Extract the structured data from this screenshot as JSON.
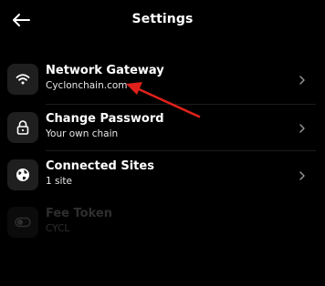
{
  "header": {
    "title": "Settings",
    "back_icon": "arrow-left-icon"
  },
  "settings": [
    {
      "label": "Network Gateway",
      "sub": "Cyclonchain.com",
      "icon": "wifi-icon",
      "enabled": true
    },
    {
      "label": "Change Password",
      "sub": "Your own chain",
      "icon": "lock-icon",
      "enabled": true
    },
    {
      "label": "Connected Sites",
      "sub": "1 site",
      "icon": "globe-icon",
      "enabled": true
    },
    {
      "label": "Fee Token",
      "sub": "CYCL",
      "icon": "toggle-icon",
      "enabled": false
    }
  ],
  "colors": {
    "background": "#000000",
    "text": "#ffffff",
    "tile": "#1f1f1f",
    "disabled_text": "#2e2e2e",
    "annotation_arrow": "#e0211b"
  },
  "annotation": {
    "icon": "red-arrow-icon"
  }
}
